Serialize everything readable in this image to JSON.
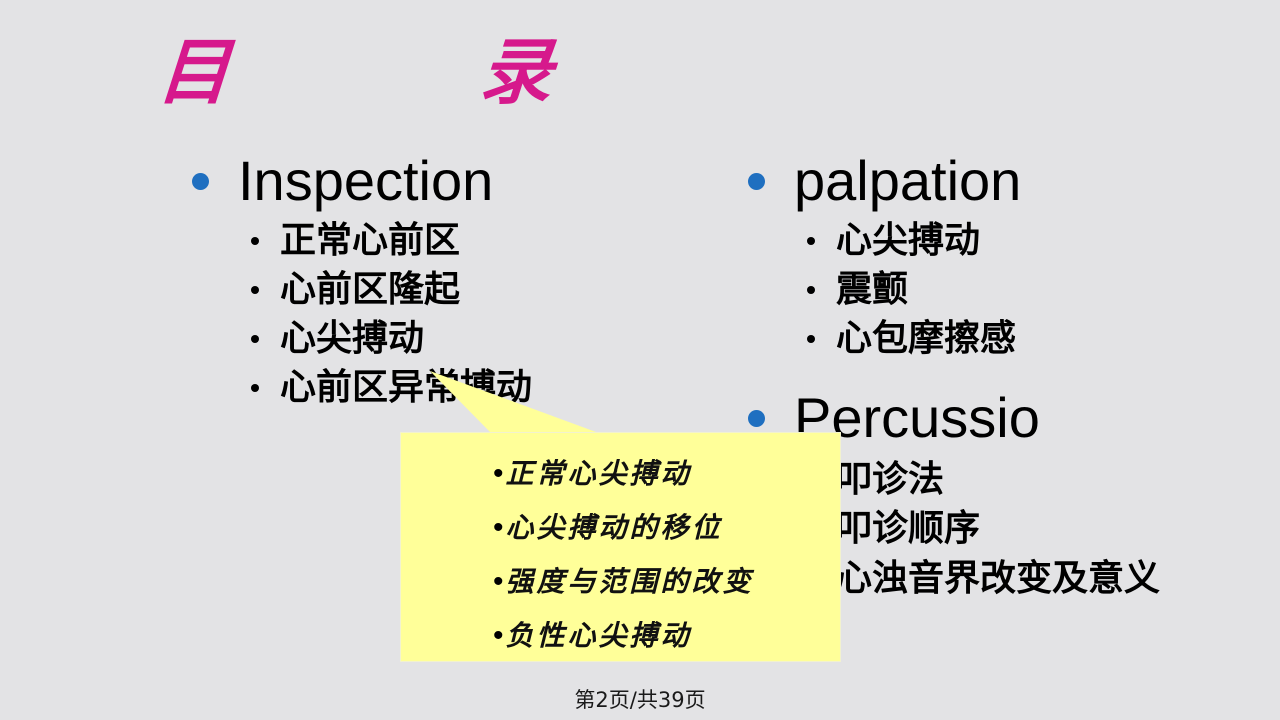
{
  "slide": {
    "title": "目    录",
    "title_color": "#d6198c",
    "background_color": "#e3e3e5",
    "bullet_color": "#1f6fc0",
    "callout_color": "#ffff99"
  },
  "columns": {
    "left": [
      {
        "label": "Inspection",
        "sub_items": [
          "正常心前区",
          "心前区隆起",
          "心尖搏动",
          "心前区异常搏动"
        ]
      }
    ],
    "right": [
      {
        "label": "palpation",
        "sub_items": [
          "心尖搏动",
          "震颤",
          "心包摩擦感"
        ]
      },
      {
        "label": "Percussio",
        "sub_items": [
          "叩诊法",
          "叩诊顺序",
          "心浊音界改变及意义"
        ]
      }
    ]
  },
  "callout": {
    "bullet_glyph": "•",
    "lines": [
      "正常心尖搏动",
      "心尖搏动的移位",
      "强度与范围的改变",
      "负性心尖搏动"
    ]
  },
  "footer": {
    "page_label": "第2页/共39页"
  }
}
